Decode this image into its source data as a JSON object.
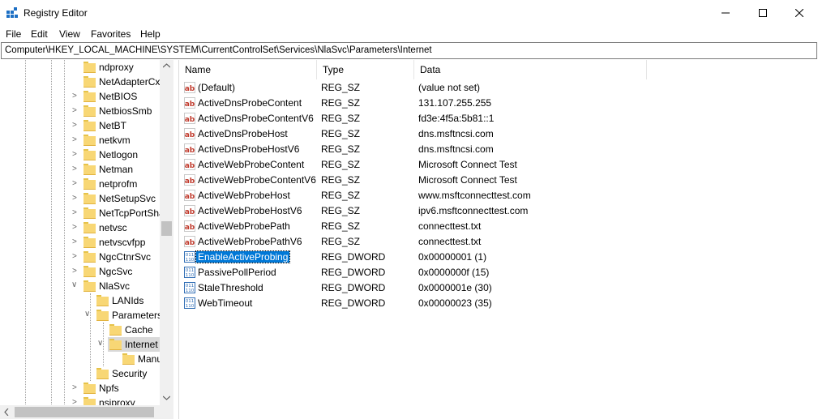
{
  "window": {
    "title": "Registry Editor"
  },
  "menu": [
    "File",
    "Edit",
    "View",
    "Favorites",
    "Help"
  ],
  "address": "Computer\\HKEY_LOCAL_MACHINE\\SYSTEM\\CurrentControlSet\\Services\\NlaSvc\\Parameters\\Internet",
  "tree": [
    {
      "label": "ndproxy",
      "chev": ""
    },
    {
      "label": "NetAdapterCx",
      "chev": ""
    },
    {
      "label": "NetBIOS",
      "chev": ">"
    },
    {
      "label": "NetbiosSmb",
      "chev": ">"
    },
    {
      "label": "NetBT",
      "chev": ">"
    },
    {
      "label": "netkvm",
      "chev": ">"
    },
    {
      "label": "Netlogon",
      "chev": ">"
    },
    {
      "label": "Netman",
      "chev": ">"
    },
    {
      "label": "netprofm",
      "chev": ">"
    },
    {
      "label": "NetSetupSvc",
      "chev": ">"
    },
    {
      "label": "NetTcpPortSha",
      "chev": ">"
    },
    {
      "label": "netvsc",
      "chev": ">"
    },
    {
      "label": "netvscvfpp",
      "chev": ">"
    },
    {
      "label": "NgcCtnrSvc",
      "chev": ">"
    },
    {
      "label": "NgcSvc",
      "chev": ">"
    },
    {
      "label": "NlaSvc",
      "chev": "v"
    },
    {
      "label": "LANIds",
      "chev": ""
    },
    {
      "label": "Parameters",
      "chev": "v"
    },
    {
      "label": "Cache",
      "chev": ""
    },
    {
      "label": "Internet",
      "chev": "v"
    },
    {
      "label": "Manu",
      "chev": ""
    },
    {
      "label": "Security",
      "chev": ""
    },
    {
      "label": "Npfs",
      "chev": ">"
    },
    {
      "label": "nsiproxy",
      "chev": ">"
    }
  ],
  "columns": {
    "name": "Name",
    "type": "Type",
    "data": "Data"
  },
  "values": [
    {
      "name": "(Default)",
      "type": "REG_SZ",
      "data": "(value not set)",
      "icon": "string-value-icon"
    },
    {
      "name": "ActiveDnsProbeContent",
      "type": "REG_SZ",
      "data": "131.107.255.255",
      "icon": "string-value-icon"
    },
    {
      "name": "ActiveDnsProbeContentV6",
      "type": "REG_SZ",
      "data": "fd3e:4f5a:5b81::1",
      "icon": "string-value-icon"
    },
    {
      "name": "ActiveDnsProbeHost",
      "type": "REG_SZ",
      "data": "dns.msftncsi.com",
      "icon": "string-value-icon"
    },
    {
      "name": "ActiveDnsProbeHostV6",
      "type": "REG_SZ",
      "data": "dns.msftncsi.com",
      "icon": "string-value-icon"
    },
    {
      "name": "ActiveWebProbeContent",
      "type": "REG_SZ",
      "data": "Microsoft Connect Test",
      "icon": "string-value-icon"
    },
    {
      "name": "ActiveWebProbeContentV6",
      "type": "REG_SZ",
      "data": "Microsoft Connect Test",
      "icon": "string-value-icon"
    },
    {
      "name": "ActiveWebProbeHost",
      "type": "REG_SZ",
      "data": "www.msftconnecttest.com",
      "icon": "string-value-icon"
    },
    {
      "name": "ActiveWebProbeHostV6",
      "type": "REG_SZ",
      "data": "ipv6.msftconnecttest.com",
      "icon": "string-value-icon"
    },
    {
      "name": "ActiveWebProbePath",
      "type": "REG_SZ",
      "data": "connecttest.txt",
      "icon": "string-value-icon"
    },
    {
      "name": "ActiveWebProbePathV6",
      "type": "REG_SZ",
      "data": "connecttest.txt",
      "icon": "string-value-icon"
    },
    {
      "name": "EnableActiveProbing",
      "type": "REG_DWORD",
      "data": "0x00000001 (1)",
      "icon": "dword-value-icon",
      "selected": true
    },
    {
      "name": "PassivePollPeriod",
      "type": "REG_DWORD",
      "data": "0x0000000f (15)",
      "icon": "dword-value-icon"
    },
    {
      "name": "StaleThreshold",
      "type": "REG_DWORD",
      "data": "0x0000001e (30)",
      "icon": "dword-value-icon"
    },
    {
      "name": "WebTimeout",
      "type": "REG_DWORD",
      "data": "0x00000023 (35)",
      "icon": "dword-value-icon"
    }
  ],
  "colors": {
    "selection": "#0078d7",
    "folder": "#f8d775",
    "string_icon": "#c0392b",
    "dword_icon": "#2f6db5"
  }
}
